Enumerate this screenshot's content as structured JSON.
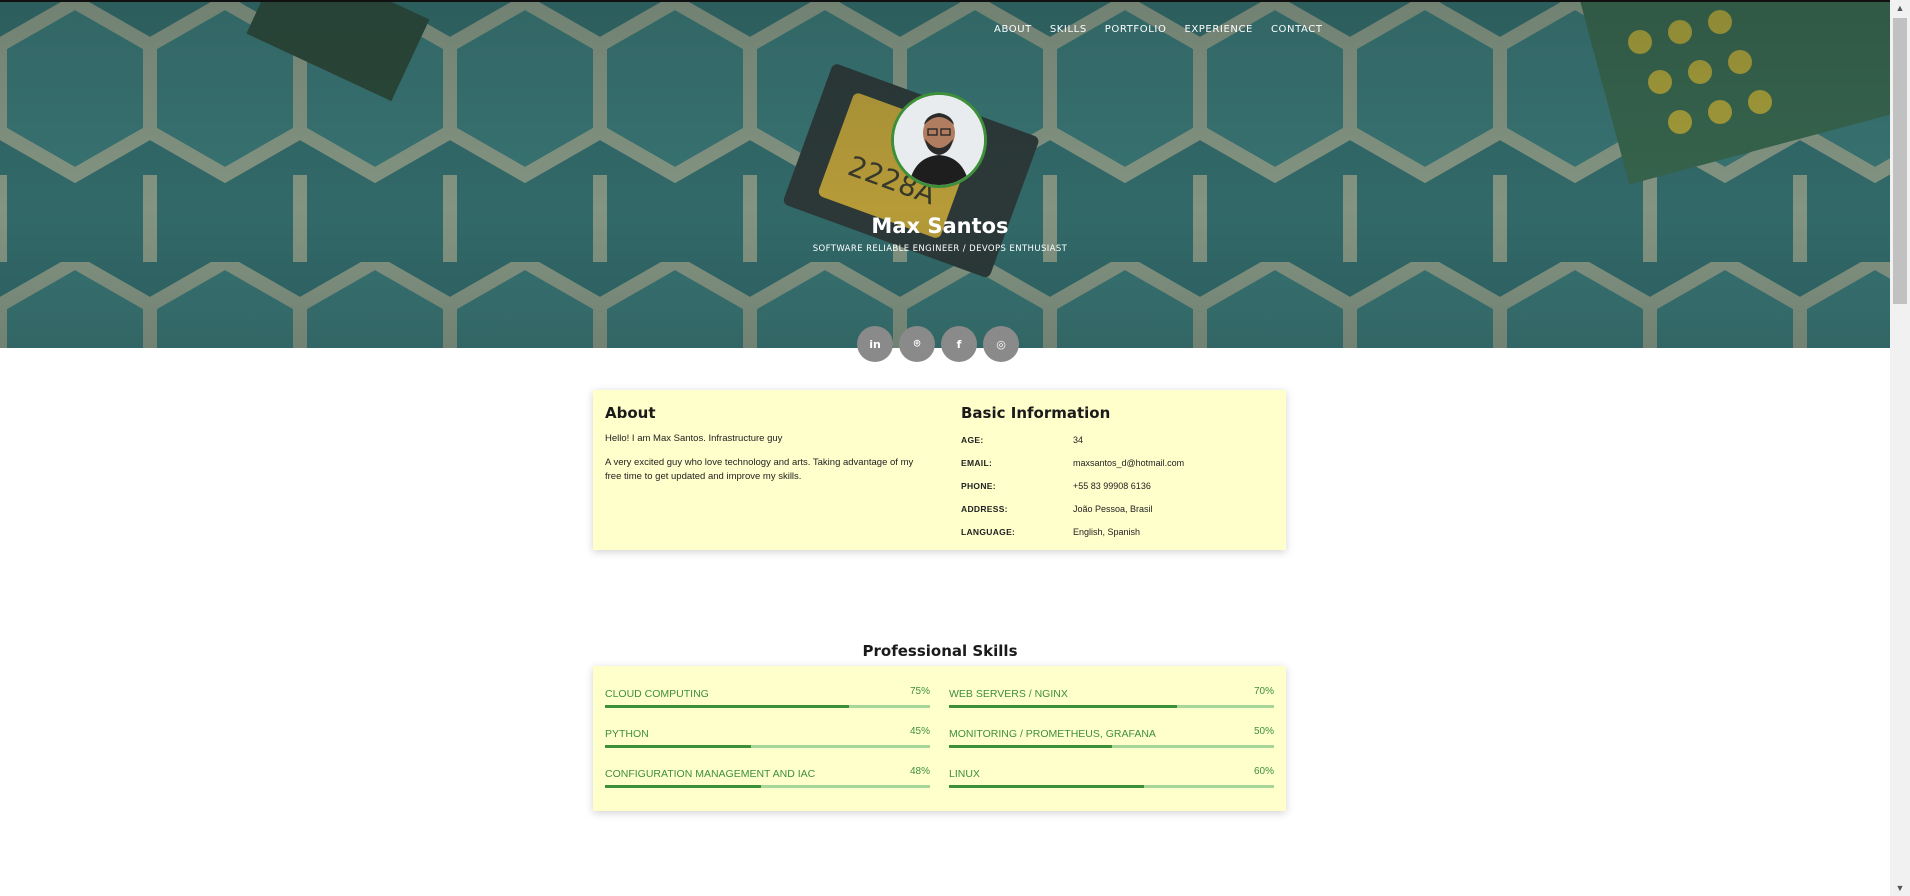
{
  "nav": {
    "items": [
      "ABOUT",
      "SKILLS",
      "PORTFOLIO",
      "EXPERIENCE",
      "CONTACT"
    ]
  },
  "hero": {
    "name": "Max Santos",
    "title": "SOFTWARE RELIABLE ENGINEER / DEVOPS ENTHUSIAST"
  },
  "socials": [
    {
      "icon": "linkedin-icon",
      "glyph": "in"
    },
    {
      "icon": "github-icon",
      "glyph": "⌾"
    },
    {
      "icon": "facebook-icon",
      "glyph": "f"
    },
    {
      "icon": "instagram-icon",
      "glyph": "◎"
    }
  ],
  "about": {
    "heading": "About",
    "p1": "Hello! I am Max Santos. Infrastructure guy",
    "p2": "A very excited guy who love technology and arts. Taking advantage of my free time to get updated and improve my skills."
  },
  "basic_info": {
    "heading": "Basic Information",
    "rows": [
      {
        "label": "AGE:",
        "value": "34"
      },
      {
        "label": "EMAIL:",
        "value": "maxsantos_d@hotmail.com"
      },
      {
        "label": "PHONE:",
        "value": "+55 83 99908 6136"
      },
      {
        "label": "ADDRESS:",
        "value": "João Pessoa, Brasil"
      },
      {
        "label": "LANGUAGE:",
        "value": "English, Spanish"
      }
    ]
  },
  "skills": {
    "heading": "Professional Skills",
    "items": [
      {
        "name": "CLOUD COMPUTING",
        "pct_label": "75%",
        "value": 75
      },
      {
        "name": "WEB SERVERS / NGINX",
        "pct_label": "70%",
        "value": 70
      },
      {
        "name": "PYTHON",
        "pct_label": "45%",
        "value": 45
      },
      {
        "name": "MONITORING / PROMETHEUS, GRAFANA",
        "pct_label": "50%",
        "value": 50
      },
      {
        "name": "CONFIGURATION MANAGEMENT AND IAC",
        "pct_label": "48%",
        "value": 48
      },
      {
        "name": "LINUX",
        "pct_label": "60%",
        "value": 60
      }
    ]
  },
  "colors": {
    "accent": "#3e8f3a",
    "accent_light": "#a8d59a",
    "card_bg": "#ffffcc",
    "hero_bg": "#3a7776"
  }
}
